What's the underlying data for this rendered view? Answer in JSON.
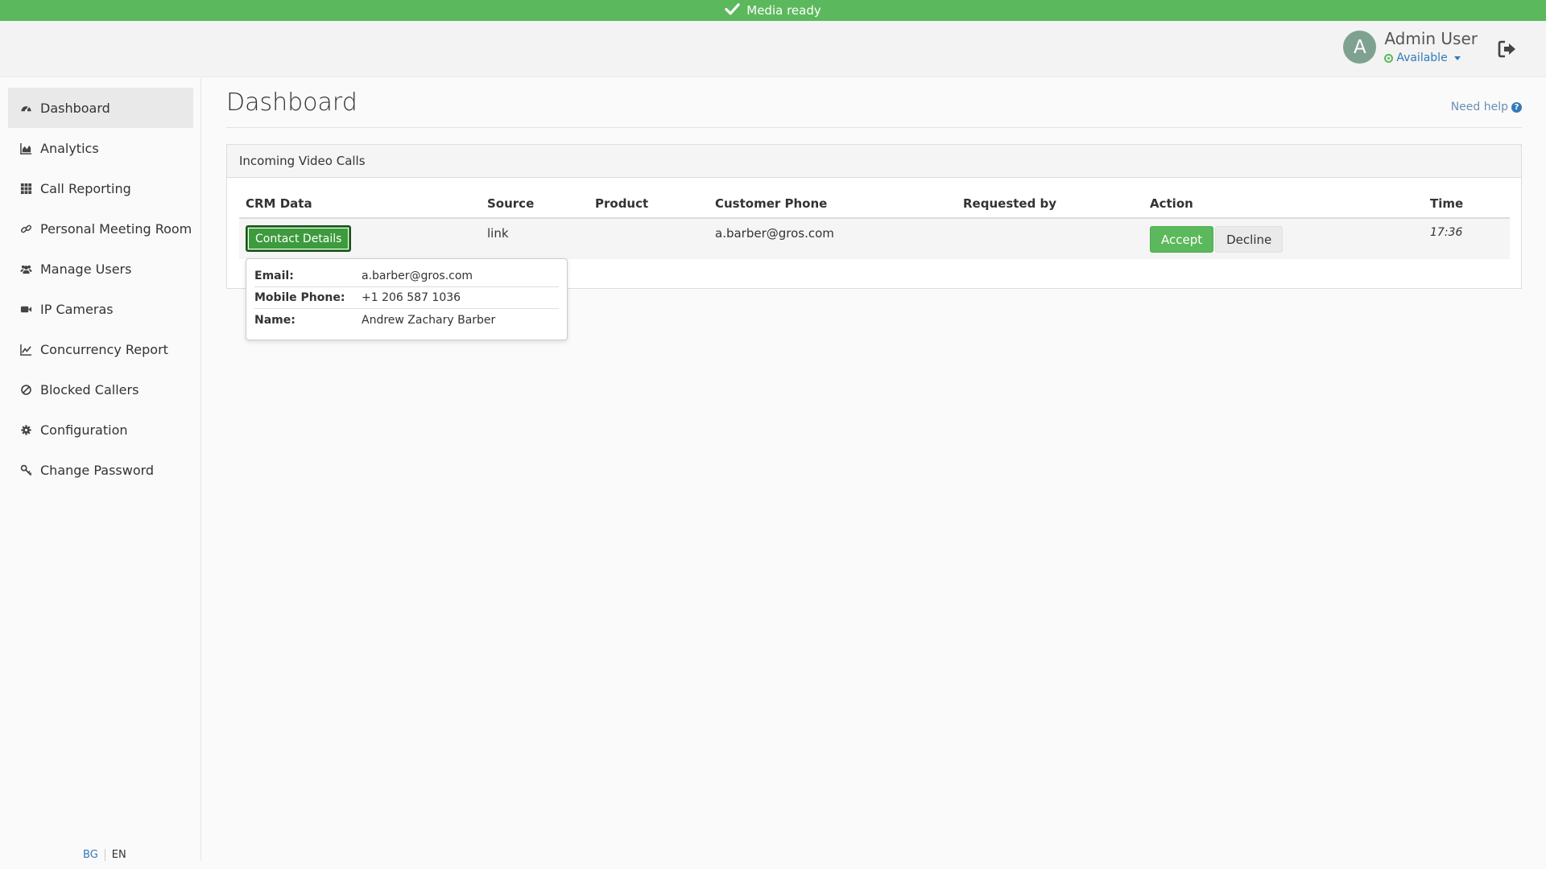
{
  "topbar": {
    "message": "Media ready",
    "icon": "check-icon",
    "color": "#5cb85c"
  },
  "header": {
    "avatar_letter": "A",
    "user_name": "Admin User",
    "status": "Available",
    "logout_icon": "sign-out-icon"
  },
  "sidebar": {
    "items": [
      {
        "label": "Dashboard",
        "icon": "dashboard-icon",
        "active": true
      },
      {
        "label": "Analytics",
        "icon": "area-chart-icon"
      },
      {
        "label": "Call Reporting",
        "icon": "grid-icon"
      },
      {
        "label": "Personal Meeting Room",
        "icon": "link-icon"
      },
      {
        "label": "Manage Users",
        "icon": "users-icon"
      },
      {
        "label": "IP Cameras",
        "icon": "video-camera-icon"
      },
      {
        "label": "Concurrency Report",
        "icon": "line-chart-icon"
      },
      {
        "label": "Blocked Callers",
        "icon": "ban-icon"
      },
      {
        "label": "Configuration",
        "icon": "gear-icon"
      },
      {
        "label": "Change Password",
        "icon": "key-icon"
      }
    ],
    "languages": [
      "BG",
      "EN"
    ]
  },
  "main": {
    "title": "Dashboard",
    "help": "Need help",
    "panel": {
      "heading": "Incoming Video Calls",
      "columns": [
        "CRM Data",
        "Source",
        "Product",
        "Customer Phone",
        "Requested by",
        "Action",
        "Time"
      ],
      "row": {
        "crm_button": "Contact Details",
        "source": "link",
        "product": "",
        "customer_phone": "a.barber@gros.com",
        "requested_by": "",
        "accept": "Accept",
        "decline": "Decline",
        "time": "17:36"
      }
    },
    "popover": [
      {
        "label": "Email:",
        "value": "a.barber@gros.com"
      },
      {
        "label": "Mobile Phone:",
        "value": "+1 206 587 1036"
      },
      {
        "label": "Name:",
        "value": "Andrew Zachary Barber"
      }
    ]
  }
}
